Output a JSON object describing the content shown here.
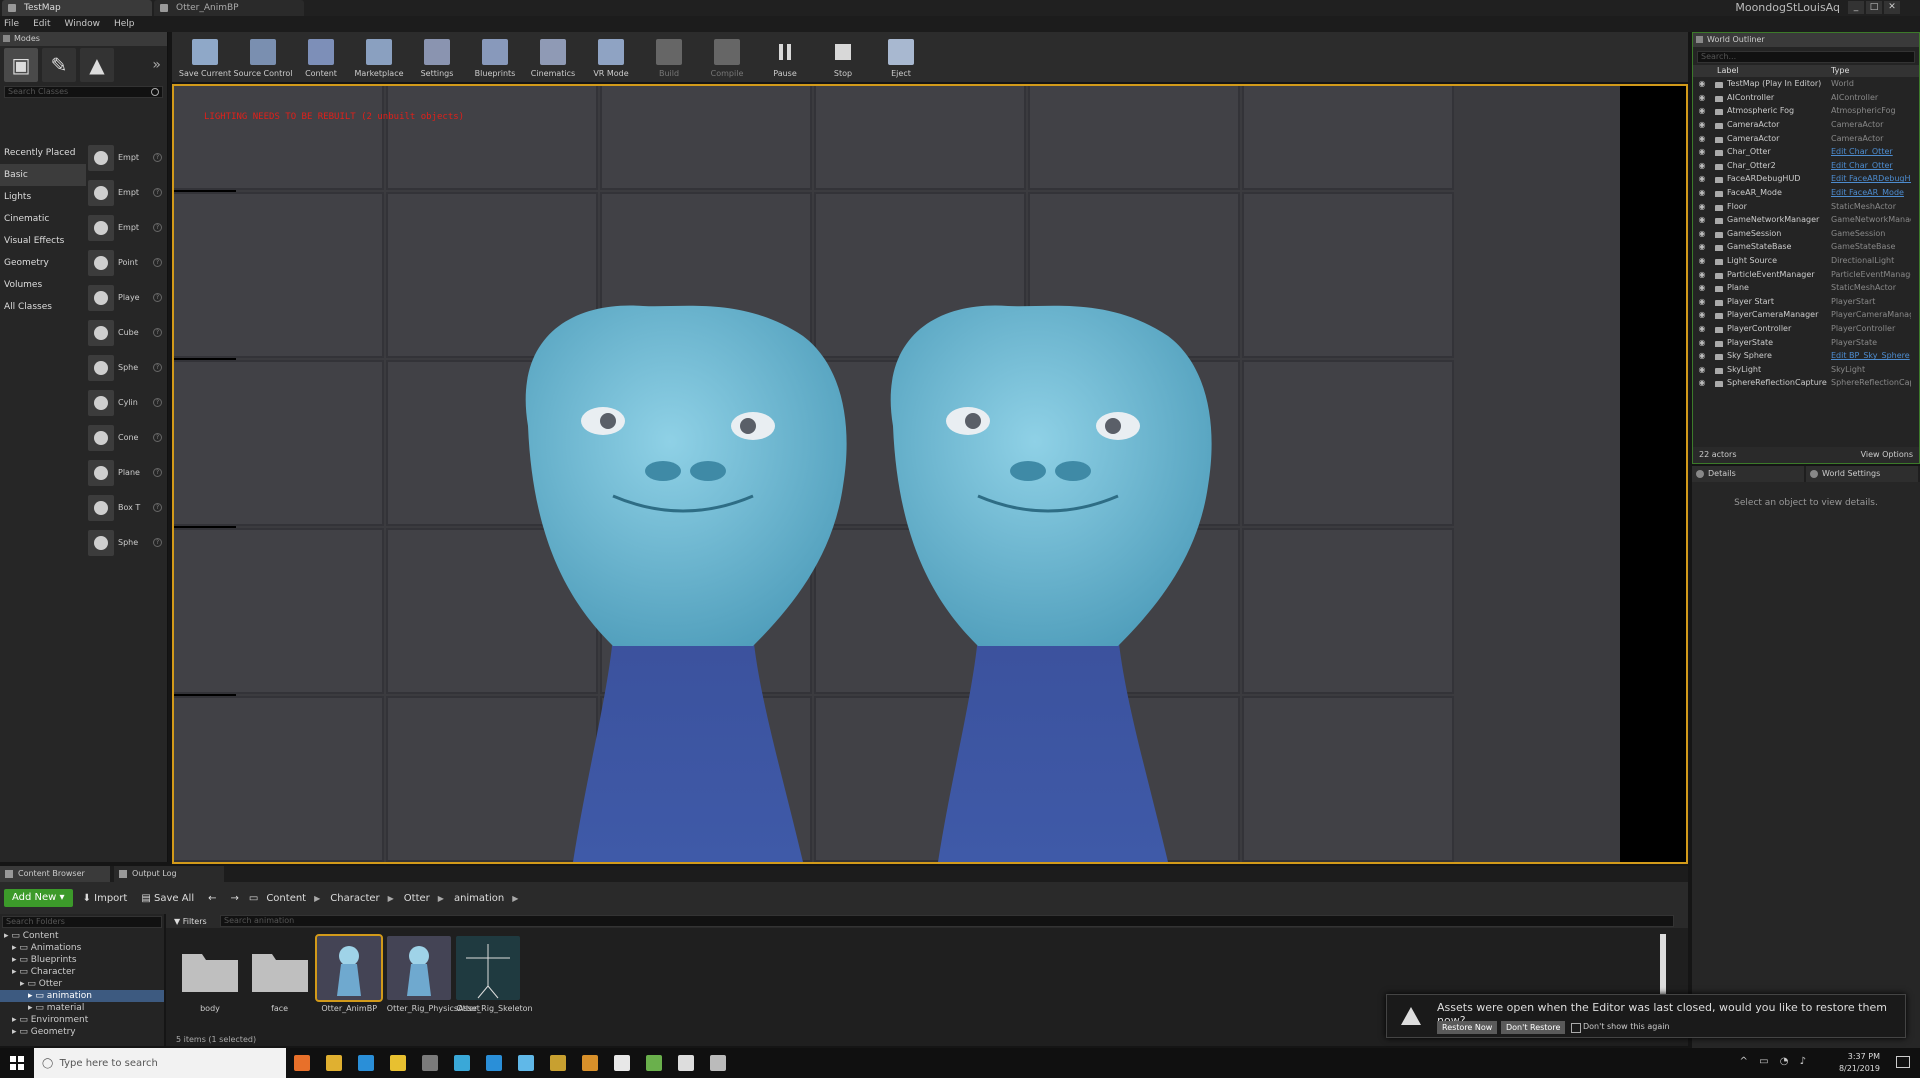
{
  "titlebar": {
    "tabs": [
      {
        "label": "TestMap"
      },
      {
        "label": "Otter_AnimBP"
      }
    ],
    "user": "MoondogStLouisAq"
  },
  "menu": [
    "File",
    "Edit",
    "Window",
    "Help"
  ],
  "modes": {
    "tab_label": "Modes",
    "search_placeholder": "Search Classes",
    "categories": [
      "Recently Placed",
      "Basic",
      "Lights",
      "Cinematic",
      "Visual Effects",
      "Geometry",
      "Volumes",
      "All Classes"
    ],
    "items": [
      "Empt",
      "Empt",
      "Empt",
      "Point",
      "Playe",
      "Cube",
      "Sphe",
      "Cylin",
      "Cone",
      "Plane",
      "Box T",
      "Sphe"
    ]
  },
  "toolbar": [
    {
      "label": "Save Current",
      "color": "#8fa8c8"
    },
    {
      "label": "Source Control",
      "color": "#7a8fb0"
    },
    {
      "label": "Content",
      "color": "#7d8fb8"
    },
    {
      "label": "Marketplace",
      "color": "#8aa0c0"
    },
    {
      "label": "Settings",
      "color": "#8a94b0"
    },
    {
      "label": "Blueprints",
      "color": "#8899bb"
    },
    {
      "label": "Cinematics",
      "color": "#8f9ab5"
    },
    {
      "label": "VR Mode",
      "color": "#8fa3c3"
    },
    {
      "label": "Build",
      "color": "#666666",
      "disabled": true
    },
    {
      "label": "Compile",
      "color": "#666666",
      "disabled": true
    },
    {
      "label": "Pause",
      "color": "#d8d8d8"
    },
    {
      "label": "Stop",
      "color": "#d8d8d8"
    },
    {
      "label": "Eject",
      "color": "#a8b8d0"
    }
  ],
  "viewport": {
    "warning": "LIGHTING NEEDS TO BE REBUILT (2 unbuilt objects)"
  },
  "outliner": {
    "tab_label": "World Outliner",
    "search_placeholder": "Search...",
    "col_label": "Label",
    "col_type": "Type",
    "rows": [
      {
        "label": "TestMap (Play In Editor)",
        "type": "World"
      },
      {
        "label": "AIController",
        "type": "AIController"
      },
      {
        "label": "Atmospheric Fog",
        "type": "AtmosphericFog"
      },
      {
        "label": "CameraActor",
        "type": "CameraActor"
      },
      {
        "label": "CameraActor",
        "type": "CameraActor"
      },
      {
        "label": "Char_Otter",
        "type": "Edit Char_Otter",
        "link": true
      },
      {
        "label": "Char_Otter2",
        "type": "Edit Char_Otter",
        "link": true
      },
      {
        "label": "FaceARDebugHUD",
        "type": "Edit FaceARDebugHUD",
        "link": true
      },
      {
        "label": "FaceAR_Mode",
        "type": "Edit FaceAR_Mode",
        "link": true
      },
      {
        "label": "Floor",
        "type": "StaticMeshActor"
      },
      {
        "label": "GameNetworkManager",
        "type": "GameNetworkManager"
      },
      {
        "label": "GameSession",
        "type": "GameSession"
      },
      {
        "label": "GameStateBase",
        "type": "GameStateBase"
      },
      {
        "label": "Light Source",
        "type": "DirectionalLight"
      },
      {
        "label": "ParticleEventManager",
        "type": "ParticleEventManager"
      },
      {
        "label": "Plane",
        "type": "StaticMeshActor"
      },
      {
        "label": "Player Start",
        "type": "PlayerStart"
      },
      {
        "label": "PlayerCameraManager",
        "type": "PlayerCameraManager"
      },
      {
        "label": "PlayerController",
        "type": "PlayerController"
      },
      {
        "label": "PlayerState",
        "type": "PlayerState"
      },
      {
        "label": "Sky Sphere",
        "type": "Edit BP_Sky_Sphere",
        "link": true
      },
      {
        "label": "SkyLight",
        "type": "SkyLight"
      },
      {
        "label": "SphereReflectionCapture",
        "type": "SphereReflectionCapture"
      }
    ],
    "count": "22 actors",
    "view_options": "View Options"
  },
  "details": {
    "tab_details": "Details",
    "tab_world": "World Settings",
    "message": "Select an object to view details."
  },
  "content_browser": {
    "tabs": [
      "Content Browser",
      "Output Log"
    ],
    "add_new": "Add New",
    "import": "Import",
    "save_all": "Save All",
    "breadcrumb": [
      "Content",
      "Character",
      "Otter",
      "animation"
    ],
    "folder_search": "Search Folders",
    "asset_search": "Search animation",
    "filters": "Filters",
    "folders": [
      {
        "label": "Content",
        "indent": 0
      },
      {
        "label": "Animations",
        "indent": 1
      },
      {
        "label": "Blueprints",
        "indent": 1
      },
      {
        "label": "Character",
        "indent": 1
      },
      {
        "label": "Otter",
        "indent": 2
      },
      {
        "label": "animation",
        "indent": 3,
        "selected": true
      },
      {
        "label": "material",
        "indent": 3
      },
      {
        "label": "Environment",
        "indent": 1
      },
      {
        "label": "Geometry",
        "indent": 1
      }
    ],
    "assets": [
      {
        "name": "body",
        "kind": "folder"
      },
      {
        "name": "face",
        "kind": "folder"
      },
      {
        "name": "Otter_AnimBP",
        "kind": "anim",
        "selected": true
      },
      {
        "name": "Otter_Rig_PhysicsAsset",
        "kind": "anim"
      },
      {
        "name": "Otter_Rig_Skeleton",
        "kind": "skeleton"
      }
    ],
    "item_count": "5 items (1 selected)"
  },
  "toast": {
    "message": "Assets were open when the Editor was last closed, would you like to restore them now?",
    "restore": "Restore Now",
    "dont_restore": "Don't Restore",
    "dont_show": "Don't show this again"
  },
  "taskbar": {
    "search_placeholder": "Type here to search",
    "time": "3:37 PM",
    "date": "8/21/2019"
  }
}
